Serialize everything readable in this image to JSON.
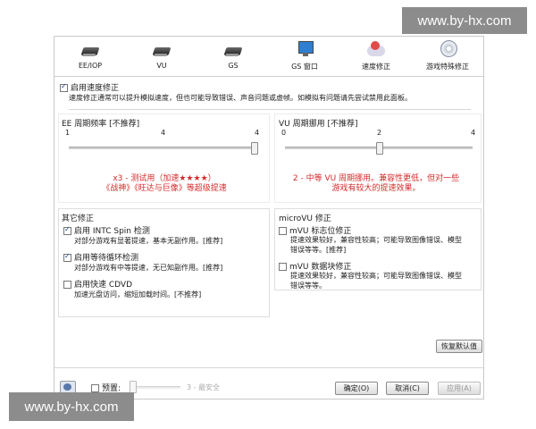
{
  "watermark": "www.by-hx.com",
  "tabs": [
    {
      "label": "EE/IOP",
      "icon": "chip-icon"
    },
    {
      "label": "VU",
      "icon": "chip-icon"
    },
    {
      "label": "GS",
      "icon": "chip-icon"
    },
    {
      "label": "GS 窗口",
      "icon": "monitor-icon"
    },
    {
      "label": "速度修正",
      "icon": "cloud-icon"
    },
    {
      "label": "游戏特殊修正",
      "icon": "disc-icon"
    }
  ],
  "speedhack": {
    "enable_label": "启用速度修正",
    "enabled": true,
    "description": "速度修正通常可以提升模拟速度，但也可能导致错误、声音问题或虚帧。如模拟有问题请先尝试禁用此面板。"
  },
  "ee_cycle": {
    "title": "EE 周期频率 [不推荐]",
    "tick_labels": [
      "1",
      "4",
      "4"
    ],
    "value": 3,
    "max": 3,
    "desc_line1": "x3 - 测试用（加速★★★★）",
    "desc_line2": "《战神》《旺达与巨像》等超级提速"
  },
  "vu_cycle": {
    "title": "VU 周期挪用 [不推荐]",
    "tick_labels": [
      "0",
      "2",
      "4"
    ],
    "value": 2,
    "max": 4,
    "desc_line1": "2 - 中等 VU 周期挪用。兼容性更低，但对一些",
    "desc_line2": "游戏有较大的提速效果。"
  },
  "other": {
    "title": "其它修正",
    "items": [
      {
        "label": "启用 INTC Spin 检测",
        "checked": true,
        "desc": "对部分游戏有显著提速，基本无副作用。[推荐]"
      },
      {
        "label": "启用等待循环检测",
        "checked": true,
        "desc": "对部分游戏有中等提速，无已知副作用。[推荐]"
      },
      {
        "label": "启用快速 CDVD",
        "checked": false,
        "desc": "加速光盘访问，缩短加载时间。[不推荐]"
      }
    ]
  },
  "microvu": {
    "title": "microVU 修正",
    "items": [
      {
        "label": "mVU 标志位修正",
        "checked": false,
        "desc1": "提速效果较好，兼容性较高；可能导致图像错误、模型",
        "desc2": "错误等等。[推荐]"
      },
      {
        "label": "mVU 数据块修正",
        "checked": false,
        "desc1": "提速效果较好，兼容性较高；可能导致图像错误、模型",
        "desc2": "错误等等。"
      }
    ]
  },
  "restore_defaults": "恢复默认值",
  "footer": {
    "preset_label": "预置:",
    "preset_checked": false,
    "preset_value_label": "3 - 最安全",
    "ok": "确定(O)",
    "cancel": "取消(C)",
    "apply": "应用(A)"
  }
}
